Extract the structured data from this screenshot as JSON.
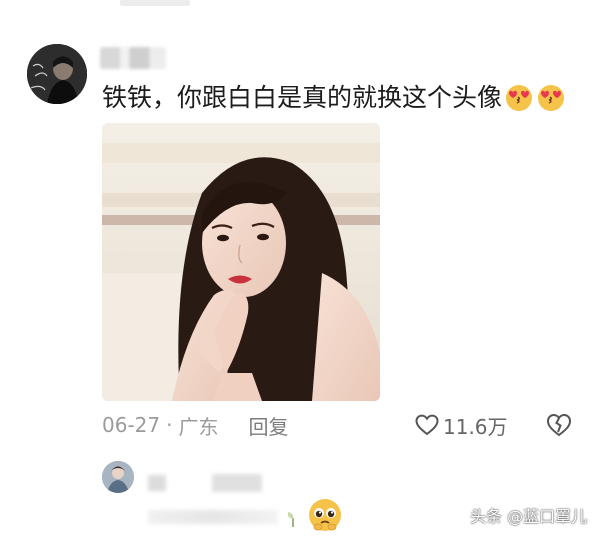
{
  "comment": {
    "text": "铁铁，你跟白白是真的就换这个头像",
    "emoji_icons": [
      "kissing-heart-face-icon",
      "kissing-heart-face-icon"
    ],
    "date": "06-27",
    "separator": "·",
    "location": "广东",
    "reply_label": "回复",
    "like_count": "11.6万"
  },
  "watermark": {
    "text": "头条 @蓝口罩儿"
  },
  "colors": {
    "meta_text": "#9b9b9b",
    "body_text": "#1c1c1c",
    "emoji_yellow": "#f6c34a",
    "heart_red": "#e8384f",
    "lipstick": "#c8323c"
  }
}
